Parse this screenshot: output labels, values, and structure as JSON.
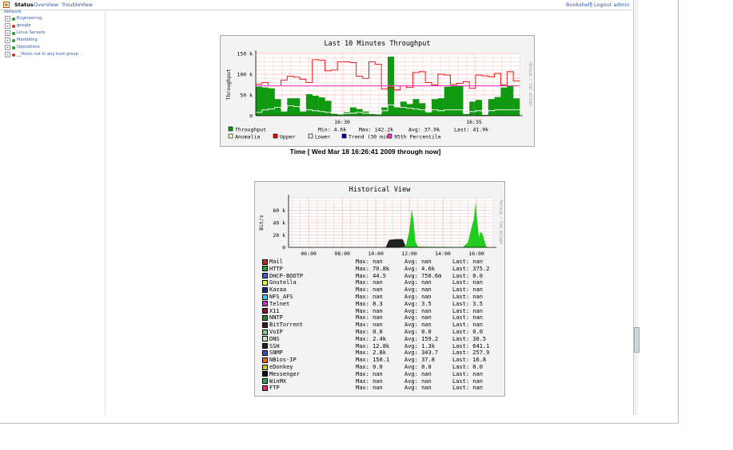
{
  "topbar": {
    "status": "Status",
    "overview": "OverView",
    "troubleview": "TroubleView",
    "bookshelf": "Bookshelf",
    "separator": "|",
    "logout": "Logout admin"
  },
  "sidebar": {
    "root": "Network",
    "items": [
      {
        "label": "Engineering",
        "status": "green"
      },
      {
        "label": "google",
        "status": "red"
      },
      {
        "label": "Linux Servers",
        "status": "green"
      },
      {
        "label": "Marketing",
        "status": "green"
      },
      {
        "label": "Operations",
        "status": "green"
      },
      {
        "label": "__Hosts not in any host group",
        "status": "red"
      }
    ]
  },
  "chart_data": [
    {
      "type": "area",
      "title": "Last 10 Minutes Throughput",
      "ylabel": "Throughput",
      "xlabel": "",
      "ylim": [
        0,
        150000
      ],
      "yticks": [
        "0",
        "50 k",
        "100 k",
        "150 k"
      ],
      "xticks": [
        "16:30",
        "16:35"
      ],
      "watermark": "PROTOCOL / TOBI OETIKER",
      "grid": true,
      "series": [
        {
          "name": "Throughput",
          "color": "#119911",
          "values": [
            70000,
            68000,
            66000,
            40000,
            10000,
            42000,
            42000,
            10000,
            52000,
            48000,
            44000,
            36000,
            5000,
            3000,
            8000,
            20000,
            16000,
            10000,
            4000,
            3000,
            20000,
            142200,
            20000,
            34000,
            28000,
            40000,
            30000,
            8000,
            40000,
            42000,
            70000,
            72000,
            72000,
            4000,
            34000,
            38000,
            2000,
            40000,
            45000,
            68000,
            72000,
            41900
          ]
        },
        {
          "name": "Upper",
          "color": "#ee0000",
          "values": [
            76000,
            80000,
            72000,
            72000,
            86000,
            95000,
            93000,
            88000,
            80000,
            135000,
            134000,
            108000,
            110000,
            130000,
            130000,
            128000,
            95000,
            90000,
            130000,
            124000,
            64000,
            68000,
            62000,
            72000,
            68000,
            104000,
            106000,
            80000,
            74000,
            100000,
            98000,
            75000,
            78000,
            82000,
            66000,
            98000,
            96000,
            94000,
            102000,
            74000,
            106000,
            84000
          ]
        },
        {
          "name": "Lower",
          "color": "#bbdddd",
          "values": [
            8000,
            14000,
            16000,
            20000,
            18000,
            24000,
            22000,
            18000,
            14000,
            12000,
            10000,
            8000,
            6000,
            5000,
            5000,
            6000,
            8000,
            6000,
            6000,
            6000,
            12000,
            26000,
            24000,
            20000,
            18000,
            16000,
            14000,
            12000,
            14000,
            12000,
            14000,
            14000,
            14000,
            8000,
            10000,
            12000,
            10000,
            12000,
            14000,
            14000,
            14000,
            14000
          ]
        },
        {
          "name": "95th Percentile",
          "color": "#ff33cc",
          "value": 72000
        }
      ],
      "legend": [
        {
          "name": "Throughput",
          "color": "#119911",
          "stats": {
            "min": "Min: 4.6k",
            "max": "Max: 142.2k",
            "avg": "Avg: 37.9k",
            "last": "Last: 41.9k"
          }
        },
        {
          "name": "Anomalia",
          "color": "#ffffcc"
        },
        {
          "name": "Upper",
          "color": "#ee0000"
        },
        {
          "name": "Lower",
          "color": "#ddeeee"
        },
        {
          "name": "Trend (30 min)",
          "color": "#0000aa"
        },
        {
          "name": "95th Percentile",
          "color": "#ff33cc"
        }
      ],
      "caption": "Time [ Wed Mar 18 16:26:41 2009 through now]"
    },
    {
      "type": "area",
      "title": "Historical View",
      "ylabel": "Bit/s",
      "xlabel": "",
      "ylim": [
        0,
        80000
      ],
      "yticks": [
        "0",
        "20 k",
        "40 k",
        "60 k"
      ],
      "xticks": [
        "06:00",
        "08:00",
        "10:00",
        "12:00",
        "14:00",
        "16:00"
      ],
      "watermark": "PROTOCOL / TOBI OETIKER",
      "grid": true,
      "http_curve": [
        [
          11.5,
          0
        ],
        [
          11.8,
          2000
        ],
        [
          12.0,
          25000
        ],
        [
          12.15,
          60000
        ],
        [
          12.25,
          40000
        ],
        [
          12.35,
          10000
        ],
        [
          12.5,
          1000
        ],
        [
          15.2,
          0
        ],
        [
          15.5,
          8000
        ],
        [
          15.7,
          30000
        ],
        [
          15.85,
          45000
        ],
        [
          15.95,
          70000
        ],
        [
          16.05,
          40000
        ],
        [
          16.15,
          15000
        ],
        [
          16.25,
          25000
        ],
        [
          16.35,
          22000
        ],
        [
          16.5,
          8000
        ],
        [
          16.6,
          0
        ]
      ],
      "ssh_curve": [
        [
          10.6,
          0
        ],
        [
          10.8,
          12000
        ],
        [
          11.2,
          13000
        ],
        [
          11.6,
          13000
        ],
        [
          11.8,
          0
        ]
      ],
      "rows": [
        {
          "name": "Mail",
          "color": "#cc2222",
          "max": "Max: nan",
          "avg": "Avg: nan",
          "last": "Last: nan"
        },
        {
          "name": "HTTP",
          "color": "#22aa22",
          "max": "Max: 70.8k",
          "avg": "Avg: 4.6k",
          "last": "Last: 375.2"
        },
        {
          "name": "DHCP-BOOTP",
          "color": "#3366cc",
          "max": "Max: 44.5",
          "avg": "Avg: 750.6m",
          "last": "Last: 0.0"
        },
        {
          "name": "Gnutella",
          "color": "#eeee33",
          "max": "Max: nan",
          "avg": "Avg: nan",
          "last": "Last: nan"
        },
        {
          "name": "Kazaa",
          "color": "#222288",
          "max": "Max: nan",
          "avg": "Avg: nan",
          "last": "Last: nan"
        },
        {
          "name": "NFS_AFS",
          "color": "#33ccee",
          "max": "Max: nan",
          "avg": "Avg: nan",
          "last": "Last: nan"
        },
        {
          "name": "Telnet",
          "color": "#cc33cc",
          "max": "Max: 8.3",
          "avg": "Avg: 3.5",
          "last": "Last: 3.5"
        },
        {
          "name": "X11",
          "color": "#881133",
          "max": "Max: nan",
          "avg": "Avg: nan",
          "last": "Last: nan"
        },
        {
          "name": "NNTP",
          "color": "#228822",
          "max": "Max: nan",
          "avg": "Avg: nan",
          "last": "Last: nan"
        },
        {
          "name": "BitTorrent",
          "color": "#441133",
          "max": "Max: nan",
          "avg": "Avg: nan",
          "last": "Last: nan"
        },
        {
          "name": "VoIP",
          "color": "#88cc88",
          "max": "Max: 0.0",
          "avg": "Avg: 0.0",
          "last": "Last: 0.0"
        },
        {
          "name": "DNS",
          "color": "#bbeebb",
          "max": "Max: 2.4k",
          "avg": "Avg: 159.2",
          "last": "Last: 30.5"
        },
        {
          "name": "SSH",
          "color": "#222222",
          "max": "Max: 12.8k",
          "avg": "Avg: 1.3k",
          "last": "Last: 641.1"
        },
        {
          "name": "SNMP",
          "color": "#3355bb",
          "max": "Max: 2.8k",
          "avg": "Avg: 343.7",
          "last": "Last: 257.9"
        },
        {
          "name": "NBios-IP",
          "color": "#ee6622",
          "max": "Max: 150.1",
          "avg": "Avg: 37.8",
          "last": "Last: 16.8"
        },
        {
          "name": "eDonkey",
          "color": "#cccc22",
          "max": "Max: 0.0",
          "avg": "Avg: 0.0",
          "last": "Last: 0.0"
        },
        {
          "name": "Messenger",
          "color": "#111111",
          "max": "Max: nan",
          "avg": "Avg: nan",
          "last": "Last: nan"
        },
        {
          "name": "WinMX",
          "color": "#22aa55",
          "max": "Max: nan",
          "avg": "Avg: nan",
          "last": "Last: nan"
        },
        {
          "name": "FTP",
          "color": "#ee2288",
          "max": "Max: nan",
          "avg": "Avg: nan",
          "last": "Last: nan"
        }
      ]
    }
  ]
}
